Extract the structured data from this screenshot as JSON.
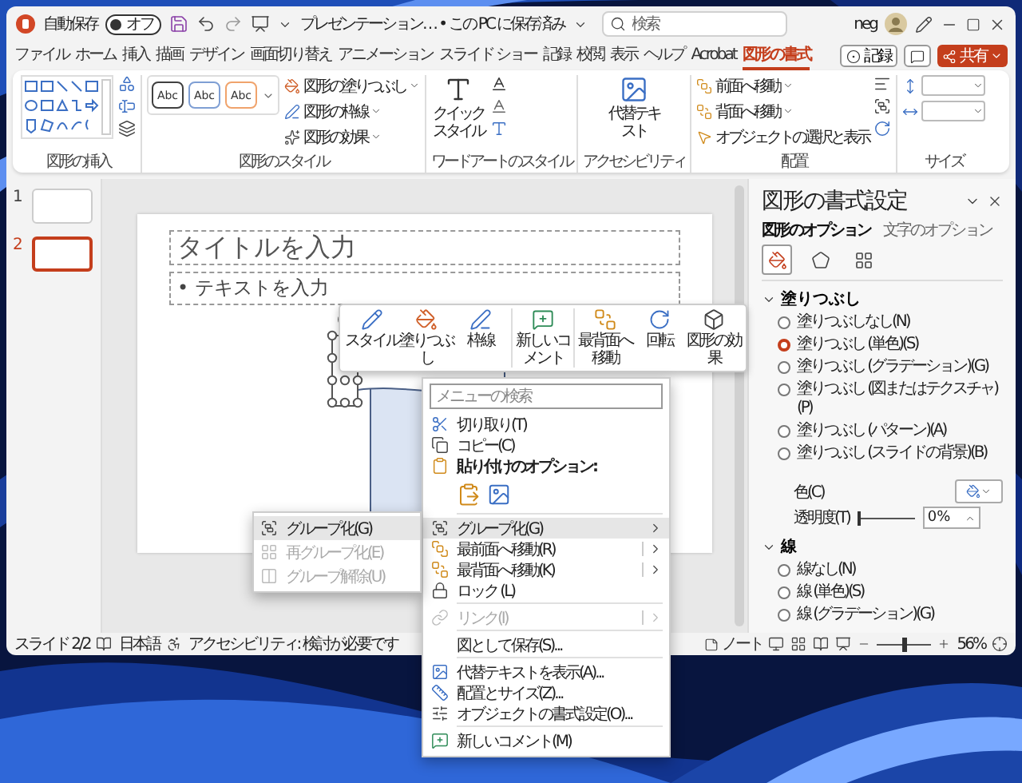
{
  "title_bar": {
    "autosave_label": "自動保存",
    "autosave": {
      "label": "オフ",
      "on": false
    },
    "document_title": "プレゼンテーション… • この PC に保存済み",
    "search_placeholder": "検索",
    "user_name": "neg"
  },
  "ribbon_tabs": [
    {
      "label": "ファイル",
      "selected": false
    },
    {
      "label": "ホーム",
      "selected": false
    },
    {
      "label": "挿入",
      "selected": false
    },
    {
      "label": "描画",
      "selected": false
    },
    {
      "label": "デザイン",
      "selected": false
    },
    {
      "label": "画面切り替え",
      "selected": false
    },
    {
      "label": "アニメーション",
      "selected": false
    },
    {
      "label": "スライド ショー",
      "selected": false
    },
    {
      "label": "記録",
      "selected": false
    },
    {
      "label": "校閲",
      "selected": false
    },
    {
      "label": "表示",
      "selected": false
    },
    {
      "label": "ヘルプ",
      "selected": false
    },
    {
      "label": "Acrobat",
      "selected": false
    },
    {
      "label": "図形の書式",
      "selected": true
    }
  ],
  "ribbon_actions": {
    "record": "記録",
    "share": "共有"
  },
  "ribbon_groups": {
    "insert_shapes": {
      "label": "図形の挿入"
    },
    "shape_styles": {
      "label": "図形のスタイル",
      "swatches": [
        {
          "text": "Abc",
          "color": "#404040"
        },
        {
          "text": "Abc",
          "color": "#7f9fd4"
        },
        {
          "text": "Abc",
          "color": "#f0a36c"
        }
      ],
      "commands": [
        "図形の塗りつぶし",
        "図形の枠線",
        "図形の効果"
      ]
    },
    "wordart_styles": {
      "label": "ワードアートのスタイル",
      "quick_style": "クイックスタイル"
    },
    "accessibility": {
      "label": "アクセシビリティ",
      "alt_text": "代替テキスト"
    },
    "arrange": {
      "label": "配置",
      "commands": [
        "前面へ移動",
        "背面へ移動",
        "オブジェクトの選択と表示"
      ]
    },
    "size": {
      "label": "サイズ"
    }
  },
  "slides": [
    {
      "number": "1",
      "selected": false
    },
    {
      "number": "2",
      "selected": true
    }
  ],
  "slide": {
    "title_placeholder": "タイトルを入力",
    "body_placeholder": "• テキストを入力"
  },
  "mini_toolbar": [
    {
      "label": "スタイル"
    },
    {
      "label": "塗りつぶし"
    },
    {
      "label": "枠線"
    },
    {
      "label": "新しいコメント"
    },
    {
      "label": "最背面へ移動"
    },
    {
      "label": "回転"
    },
    {
      "label": "図形の効果"
    }
  ],
  "context_menu": {
    "search_placeholder": "メニューの検索",
    "items": [
      {
        "kind": "item",
        "label": "切り取り(T)",
        "highlighted": false,
        "disabled": false,
        "submenu": false,
        "split": false
      },
      {
        "kind": "item",
        "label": "コピー(C)",
        "highlighted": false,
        "disabled": false,
        "submenu": false,
        "split": false
      },
      {
        "kind": "header",
        "label": "貼り付けのオプション:"
      },
      {
        "kind": "paste"
      },
      {
        "kind": "separator"
      },
      {
        "kind": "item",
        "label": "グループ化(G)",
        "highlighted": true,
        "disabled": false,
        "submenu": true,
        "split": false
      },
      {
        "kind": "item",
        "label": "最前面へ移動(R)",
        "highlighted": false,
        "disabled": false,
        "submenu": true,
        "split": true
      },
      {
        "kind": "item",
        "label": "最背面へ移動(K)",
        "highlighted": false,
        "disabled": false,
        "submenu": true,
        "split": true
      },
      {
        "kind": "item",
        "label": "ロック (L)",
        "highlighted": false,
        "disabled": false,
        "submenu": false,
        "split": false
      },
      {
        "kind": "separator"
      },
      {
        "kind": "item",
        "label": "リンク(I)",
        "highlighted": false,
        "disabled": true,
        "submenu": true,
        "split": true
      },
      {
        "kind": "separator"
      },
      {
        "kind": "item",
        "label": "図として保存(S)...",
        "highlighted": false,
        "disabled": false,
        "submenu": false,
        "split": false
      },
      {
        "kind": "separator"
      },
      {
        "kind": "item",
        "label": "代替テキストを表示(A)...",
        "highlighted": false,
        "disabled": false,
        "submenu": false,
        "split": false
      },
      {
        "kind": "item",
        "label": "配置とサイズ(Z)...",
        "highlighted": false,
        "disabled": false,
        "submenu": false,
        "split": false
      },
      {
        "kind": "item",
        "label": "オブジェクトの書式設定(O)...",
        "highlighted": false,
        "disabled": false,
        "submenu": false,
        "split": false
      },
      {
        "kind": "separator"
      },
      {
        "kind": "item",
        "label": "新しいコメント(M)",
        "highlighted": false,
        "disabled": false,
        "submenu": false,
        "split": false
      }
    ]
  },
  "submenu": {
    "items": [
      {
        "label": "グループ化(G)",
        "highlighted": true,
        "disabled": false
      },
      {
        "label": "再グループ化(E)",
        "highlighted": false,
        "disabled": true
      },
      {
        "label": "グループ解除(U)",
        "highlighted": false,
        "disabled": true
      }
    ]
  },
  "format_pane": {
    "title": "図形の書式設定",
    "tabs": [
      {
        "label": "図形のオプション",
        "selected": true
      },
      {
        "label": "文字のオプション",
        "selected": false
      }
    ],
    "icon_tabs": [
      {
        "selected": true
      },
      {
        "selected": false
      },
      {
        "selected": false
      }
    ],
    "sections": [
      {
        "kind": "fill",
        "title": "塗りつぶし",
        "expanded": true,
        "options": [
          {
            "label": "塗りつぶしなし(N)",
            "selected": false
          },
          {
            "label": "塗りつぶし (単色)(S)",
            "selected": true
          },
          {
            "label": "塗りつぶし (グラデーション)(G)",
            "selected": false
          },
          {
            "label": "塗りつぶし (図またはテクスチャ)(P)",
            "selected": false
          },
          {
            "label": "塗りつぶし (パターン)(A)",
            "selected": false
          },
          {
            "label": "塗りつぶし (スライドの背景)(B)",
            "selected": false
          }
        ],
        "color_label": "色(C)",
        "transparency_label": "透明度(T)",
        "transparency": {
          "level": 0,
          "reading": "0%"
        }
      },
      {
        "kind": "line",
        "title": "線",
        "expanded": true,
        "options": [
          {
            "label": "線なし(N)",
            "selected": false
          },
          {
            "label": "線 (単色)(S)",
            "selected": false
          },
          {
            "label": "線 (グラデーション)(G)",
            "selected": false
          }
        ]
      }
    ]
  },
  "status_bar": {
    "slide": "スライド 2/2",
    "language": "日本語",
    "accessibility": "アクセシビリティ: 検討が必要です",
    "notes": "ノート",
    "zoom": {
      "level": 0.5,
      "reading": "56%"
    }
  }
}
